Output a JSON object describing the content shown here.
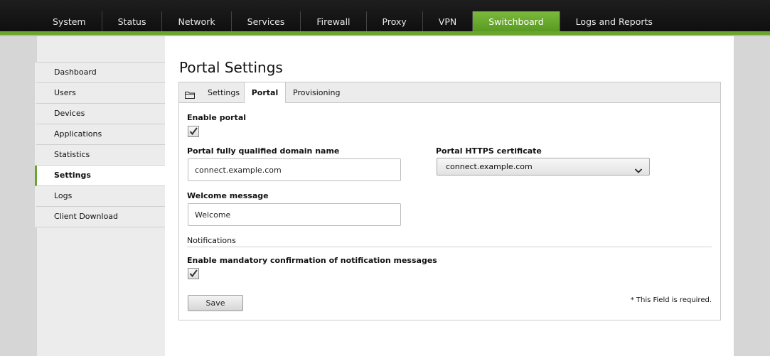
{
  "topnav": {
    "items": [
      {
        "label": "System"
      },
      {
        "label": "Status"
      },
      {
        "label": "Network"
      },
      {
        "label": "Services"
      },
      {
        "label": "Firewall"
      },
      {
        "label": "Proxy"
      },
      {
        "label": "VPN"
      },
      {
        "label": "Switchboard",
        "active": true
      },
      {
        "label": "Logs and Reports"
      }
    ]
  },
  "sidebar": {
    "items": [
      {
        "label": "Dashboard"
      },
      {
        "label": "Users"
      },
      {
        "label": "Devices"
      },
      {
        "label": "Applications"
      },
      {
        "label": "Statistics"
      },
      {
        "label": "Settings",
        "active": true
      },
      {
        "label": "Logs"
      },
      {
        "label": "Client Download"
      }
    ]
  },
  "page": {
    "title": "Portal Settings"
  },
  "tabs": {
    "icon": "folder-icon",
    "settings": "Settings",
    "portal": "Portal",
    "provisioning": "Provisioning",
    "active": "Portal"
  },
  "form": {
    "enable_portal": {
      "label": "Enable portal",
      "checked": true
    },
    "fqdn": {
      "label": "Portal fully qualified domain name",
      "value": "connect.example.com"
    },
    "certificate": {
      "label": "Portal HTTPS certificate",
      "value": "connect.example.com"
    },
    "welcome": {
      "label": "Welcome message",
      "value": "Welcome"
    },
    "notifications_heading": "Notifications",
    "mandatory_confirmation": {
      "label": "Enable mandatory confirmation of notification messages",
      "checked": true
    },
    "save_label": "Save",
    "required_note": "* This Field is required."
  },
  "colors": {
    "accent": "#6aa62b",
    "topbar": "#1a1a1a",
    "background": "#d6d6d6"
  }
}
